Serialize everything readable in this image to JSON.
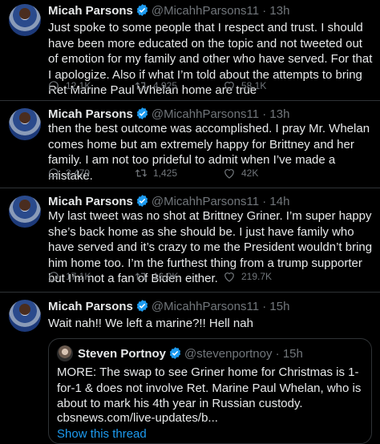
{
  "tweets": [
    {
      "name": "Micah Parsons",
      "handle": "@MicahhParsons11",
      "time": "13h",
      "text": "Just spoke to some people that I respect and trust. I should have been more educated on the topic and not tweeted out of emotion for my family and other who have served. For that I apologize. Also if what I’m told about the attempts to bring Ret Marine Paul Whelan home are true",
      "replies": "12.1K",
      "retweets": "4,925",
      "likes": "58.1K"
    },
    {
      "name": "Micah Parsons",
      "handle": "@MicahhParsons11",
      "time": "13h",
      "text": "then the best outcome was accomplished. I pray Mr. Whelan comes home but am extremely happy for Brittney and her family.  I am not too prideful to admit when I’ve made a mistake.",
      "replies": "3,479",
      "retweets": "1,425",
      "likes": "42K"
    },
    {
      "name": "Micah Parsons",
      "handle": "@MicahhParsons11",
      "time": "14h",
      "text": "My last tweet was no shot at Brittney Griner. I’m super happy she’s back home as she should be. I just have family who have served and it’s crazy to me the President wouldn’t bring him home too. I’m the furthest thing from a trump supporter but I’m not a fan of Biden either.",
      "replies": "17.1K",
      "retweets": "16.9K",
      "likes": "219.7K"
    },
    {
      "name": "Micah Parsons",
      "handle": "@MicahhParsons11",
      "time": "15h",
      "text": "Wait nah!! We left a marine?!! Hell nah"
    }
  ],
  "quote": {
    "name": "Steven Portnoy",
    "handle": "@stevenportnoy",
    "time": "15h",
    "text": "MORE: The swap to see Griner home for Christmas is 1-for-1 & does not involve Ret. Marine Paul Whelan, who is about to mark his 4th year in Russian custody.",
    "link": "cbsnews.com/live-updates/b...",
    "show_thread": "Show this thread"
  },
  "separator": "·",
  "colors": {
    "background": "#000000",
    "text": "#e7e9ea",
    "muted": "#71767b",
    "accent": "#1d9bf0",
    "border": "#2f3336"
  },
  "icons": [
    "verified-badge-icon",
    "reply-icon",
    "retweet-icon",
    "like-icon"
  ]
}
